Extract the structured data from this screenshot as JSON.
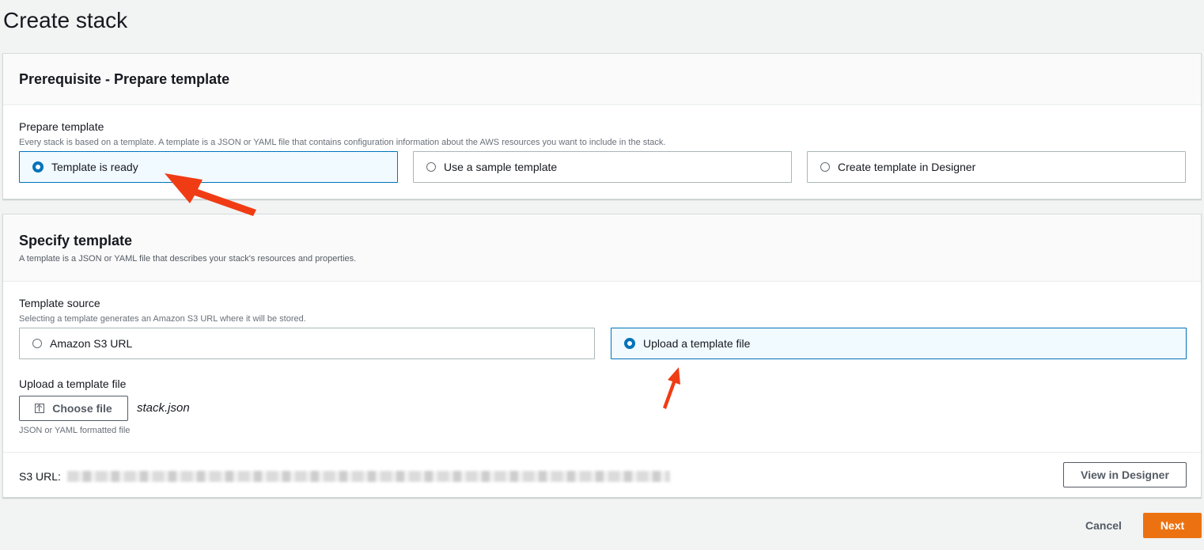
{
  "page": {
    "title": "Create stack"
  },
  "prerequisite": {
    "title": "Prerequisite - Prepare template",
    "field_label": "Prepare template",
    "field_desc": "Every stack is based on a template. A template is a JSON or YAML file that contains configuration information about the AWS resources you want to include in the stack.",
    "options": [
      {
        "label": "Template is ready",
        "selected": true
      },
      {
        "label": "Use a sample template",
        "selected": false
      },
      {
        "label": "Create template in Designer",
        "selected": false
      }
    ]
  },
  "specify": {
    "title": "Specify template",
    "desc": "A template is a JSON or YAML file that describes your stack's resources and properties.",
    "source_label": "Template source",
    "source_desc": "Selecting a template generates an Amazon S3 URL where it will be stored.",
    "options": [
      {
        "label": "Amazon S3 URL",
        "selected": false
      },
      {
        "label": "Upload a template file",
        "selected": true
      }
    ],
    "upload_label": "Upload a template file",
    "choose_file_label": "Choose file",
    "file_name": "stack.json",
    "upload_hint": "JSON or YAML formatted file",
    "s3_url_label": "S3 URL:",
    "view_designer_label": "View in Designer"
  },
  "footer": {
    "cancel_label": "Cancel",
    "next_label": "Next"
  },
  "colors": {
    "accent": "#0073bb",
    "primary": "#ec7211",
    "annotation": "#f03c14"
  }
}
